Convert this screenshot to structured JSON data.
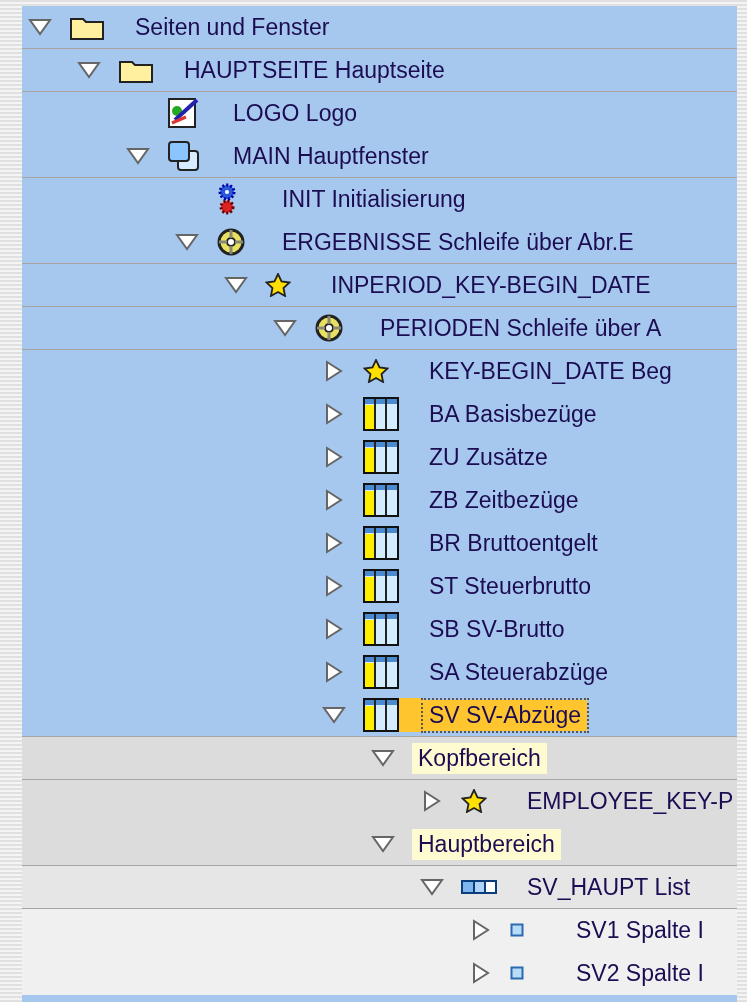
{
  "tree": [
    {
      "label": "Seiten und Fenster",
      "kind": "folder",
      "expanded": true,
      "selected": false,
      "children": [
        {
          "label": "HAUPTSEITE Hauptseite",
          "kind": "folder",
          "expanded": true,
          "selected": false,
          "children": [
            {
              "label": "LOGO Logo",
              "kind": "graphic",
              "selected": false
            },
            {
              "label": "MAIN Hauptfenster",
              "kind": "window",
              "expanded": true,
              "selected": false,
              "children": [
                {
                  "label": "INIT Initialisierung",
                  "kind": "init",
                  "selected": false
                },
                {
                  "label": "ERGEBNISSE Schleife über Abr.E",
                  "kind": "loop",
                  "expanded": true,
                  "selected": false,
                  "children": [
                    {
                      "label": "INPERIOD_KEY-BEGIN_DATE",
                      "kind": "event",
                      "expanded": true,
                      "selected": false,
                      "children": [
                        {
                          "label": "PERIODEN Schleife über A",
                          "kind": "loop",
                          "expanded": true,
                          "selected": false,
                          "children": [
                            {
                              "label": "KEY-BEGIN_DATE Beg",
                              "kind": "event",
                              "expanded": false,
                              "selected": false
                            },
                            {
                              "label": "BA Basisbezüge",
                              "kind": "table",
                              "expanded": false,
                              "selected": false
                            },
                            {
                              "label": "ZU Zusätze",
                              "kind": "table",
                              "expanded": false,
                              "selected": false
                            },
                            {
                              "label": "ZB Zeitbezüge",
                              "kind": "table",
                              "expanded": false,
                              "selected": false
                            },
                            {
                              "label": "BR Bruttoentgelt",
                              "kind": "table",
                              "expanded": false,
                              "selected": false
                            },
                            {
                              "label": "ST Steuerbrutto",
                              "kind": "table",
                              "expanded": false,
                              "selected": false
                            },
                            {
                              "label": "SB SV-Brutto",
                              "kind": "table",
                              "expanded": false,
                              "selected": false
                            },
                            {
                              "label": "SA Steuerabzüge",
                              "kind": "table",
                              "expanded": false,
                              "selected": false
                            },
                            {
                              "label": "SV SV-Abzüge",
                              "kind": "table",
                              "expanded": true,
                              "selected": true,
                              "children": [
                                {
                                  "label": "Kopfbereich",
                                  "kind": "section",
                                  "expanded": true,
                                  "selected": false,
                                  "children": [
                                    {
                                      "label": "EMPLOYEE_KEY-P",
                                      "kind": "event",
                                      "expanded": false,
                                      "selected": false
                                    }
                                  ]
                                },
                                {
                                  "label": "Hauptbereich",
                                  "kind": "section",
                                  "expanded": true,
                                  "selected": false,
                                  "children": [
                                    {
                                      "label": "SV_HAUPT List",
                                      "kind": "list",
                                      "expanded": true,
                                      "selected": false,
                                      "children": [
                                        {
                                          "label": "SV1 Spalte I",
                                          "kind": "column",
                                          "expanded": false,
                                          "selected": false
                                        },
                                        {
                                          "label": "SV2 Spalte I",
                                          "kind": "column",
                                          "expanded": false,
                                          "selected": false
                                        }
                                      ]
                                    }
                                  ]
                                }
                              ]
                            }
                          ]
                        }
                      ]
                    }
                  ]
                }
              ]
            }
          ]
        }
      ]
    }
  ]
}
